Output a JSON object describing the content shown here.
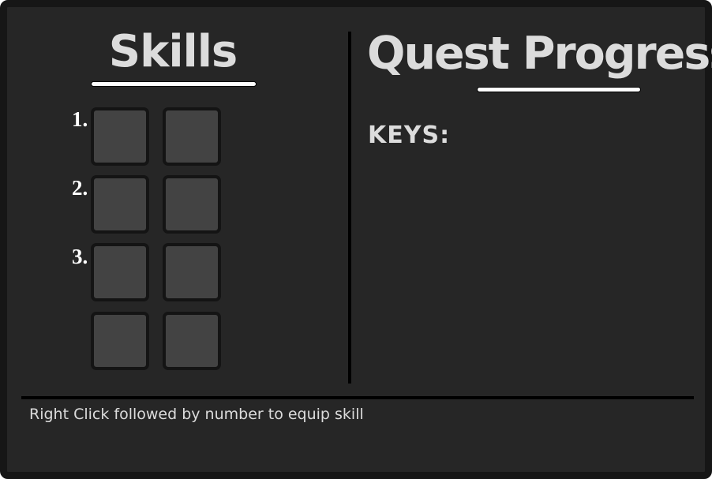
{
  "skills": {
    "title": "Skills",
    "rows": [
      {
        "number": "1."
      },
      {
        "number": "2."
      },
      {
        "number": "3."
      }
    ]
  },
  "quest": {
    "title": "Quest Progress",
    "keys_label": "KEYS:"
  },
  "footer": {
    "hint": "Right Click followed by number to equip skill"
  }
}
